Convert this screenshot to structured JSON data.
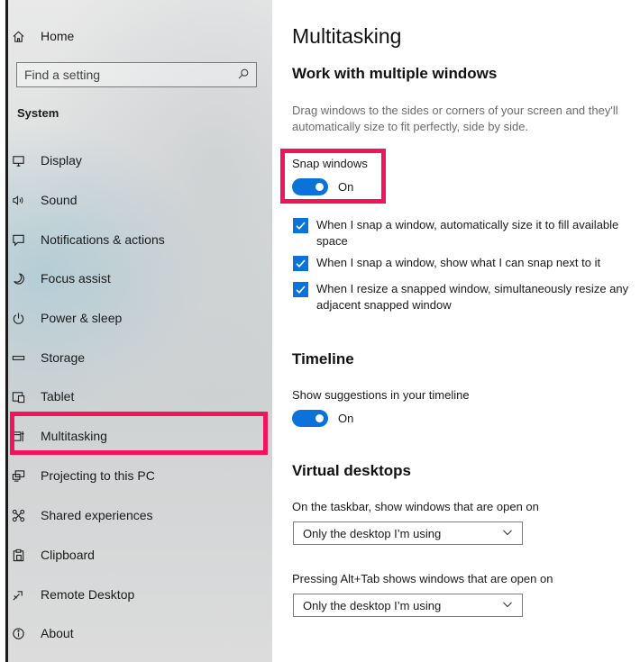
{
  "sidebar": {
    "home_label": "Home",
    "search_placeholder": "Find a setting",
    "section_label": "System",
    "items": [
      {
        "label": "Display",
        "icon": "display-icon"
      },
      {
        "label": "Sound",
        "icon": "sound-icon"
      },
      {
        "label": "Notifications & actions",
        "icon": "notifications-icon"
      },
      {
        "label": "Focus assist",
        "icon": "moon-icon"
      },
      {
        "label": "Power & sleep",
        "icon": "power-icon"
      },
      {
        "label": "Storage",
        "icon": "storage-icon"
      },
      {
        "label": "Tablet",
        "icon": "tablet-icon"
      },
      {
        "label": "Multitasking",
        "icon": "multitasking-icon",
        "selected": true
      },
      {
        "label": "Projecting to this PC",
        "icon": "projecting-icon"
      },
      {
        "label": "Shared experiences",
        "icon": "shared-experiences-icon"
      },
      {
        "label": "Clipboard",
        "icon": "clipboard-icon"
      },
      {
        "label": "Remote Desktop",
        "icon": "remote-desktop-icon"
      },
      {
        "label": "About",
        "icon": "info-icon"
      }
    ]
  },
  "main": {
    "title": "Multitasking",
    "work_heading": "Work with multiple windows",
    "work_description": "Drag windows to the sides or corners of your screen and they'll automatically size to fit perfectly, side by side.",
    "snap_label": "Snap windows",
    "snap_state": "On",
    "checks": [
      {
        "label": "When I snap a window, automatically size it to fill available space",
        "checked": true
      },
      {
        "label": "When I snap a window, show what I can snap next to it",
        "checked": true
      },
      {
        "label": "When I resize a snapped window, simultaneously resize any adjacent snapped window",
        "checked": true
      }
    ],
    "timeline_heading": "Timeline",
    "timeline_label": "Show suggestions in your timeline",
    "timeline_state": "On",
    "vd_heading": "Virtual desktops",
    "taskbar_label": "On the taskbar, show windows that are open on",
    "taskbar_value": "Only the desktop I’m using",
    "alttab_label": "Pressing Alt+Tab shows windows that are open on",
    "alttab_value": "Only the desktop I’m using"
  },
  "colors": {
    "accent": "#0a72d8",
    "highlight": "#f0145a"
  }
}
